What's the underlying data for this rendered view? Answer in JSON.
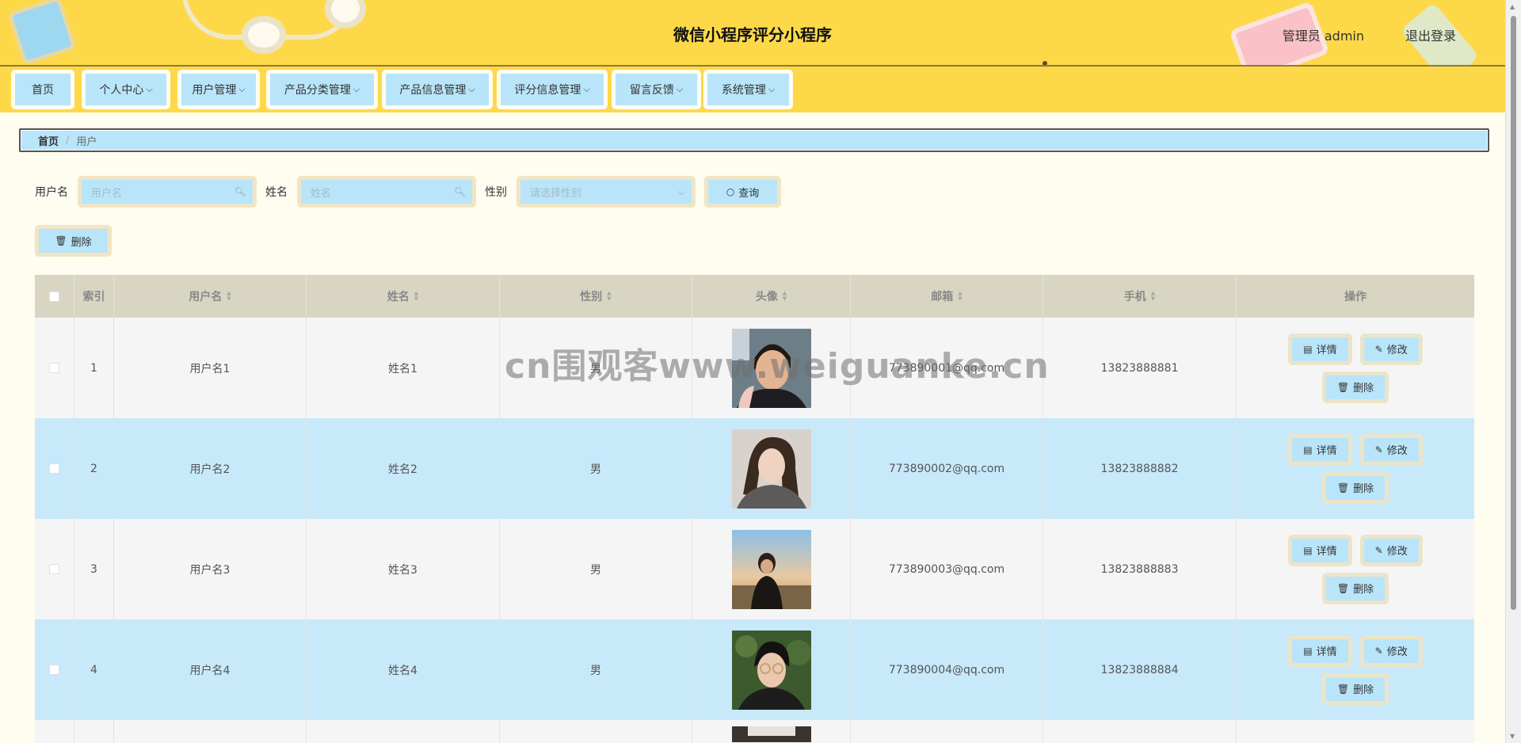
{
  "header": {
    "title": "微信小程序评分小程序",
    "user_info": "管理员 admin",
    "logout": "退出登录"
  },
  "nav": [
    {
      "label": "首页",
      "chevron": false
    },
    {
      "label": "个人中心",
      "chevron": true
    },
    {
      "label": "用户管理",
      "chevron": true
    },
    {
      "label": "产品分类管理",
      "chevron": true
    },
    {
      "label": "产品信息管理",
      "chevron": true
    },
    {
      "label": "评分信息管理",
      "chevron": true
    },
    {
      "label": "留言反馈",
      "chevron": true
    },
    {
      "label": "系统管理",
      "chevron": true
    }
  ],
  "breadcrumb": {
    "home": "首页",
    "sep": "/",
    "current": "用户"
  },
  "search": {
    "username_label": "用户名",
    "username_placeholder": "用户名",
    "name_label": "姓名",
    "name_placeholder": "姓名",
    "gender_label": "性别",
    "gender_placeholder": "请选择性别",
    "query_button": "查询"
  },
  "toolbar": {
    "delete_button": "删除"
  },
  "table": {
    "headers": {
      "index": "索引",
      "username": "用户名",
      "name": "姓名",
      "gender": "性别",
      "avatar": "头像",
      "email": "邮箱",
      "phone": "手机",
      "actions": "操作"
    },
    "actions": {
      "detail": "详情",
      "edit": "修改",
      "delete": "删除"
    },
    "rows": [
      {
        "index": "1",
        "username": "用户名1",
        "name": "姓名1",
        "gender": "男",
        "email": "773890001@qq.com",
        "phone": "13823888881"
      },
      {
        "index": "2",
        "username": "用户名2",
        "name": "姓名2",
        "gender": "男",
        "email": "773890002@qq.com",
        "phone": "13823888882"
      },
      {
        "index": "3",
        "username": "用户名3",
        "name": "姓名3",
        "gender": "男",
        "email": "773890003@qq.com",
        "phone": "13823888883"
      },
      {
        "index": "4",
        "username": "用户名4",
        "name": "姓名4",
        "gender": "男",
        "email": "773890004@qq.com",
        "phone": "13823888884"
      }
    ]
  },
  "watermark": "cn围观客www.weiguanke.cn",
  "icons": {
    "chevron": "chevron-down-icon",
    "search": "search-icon",
    "delete": "trash-icon",
    "detail": "document-icon",
    "edit": "pencil-icon"
  },
  "colors": {
    "header_bg": "#fdd94a",
    "button_bg": "#b9e5fa",
    "button_border": "#f0e5c4",
    "row_alt": "#c7e9fa",
    "page_bg": "#fffcf0"
  }
}
